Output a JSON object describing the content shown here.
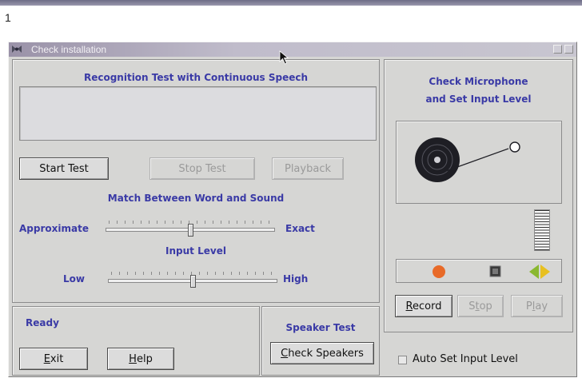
{
  "page": {
    "number": "1"
  },
  "window": {
    "title": "Check installation",
    "buttons": {
      "minimize_icon": "minimize-icon",
      "maximize_icon": "maximize-icon"
    }
  },
  "recognition": {
    "heading": "Recognition Test with Continuous Speech",
    "output_text": "",
    "start_label": "Start Test",
    "stop_label": "Stop Test",
    "playback_label": "Playback",
    "match_heading": "Match Between Word and Sound",
    "match_low_label": "Approximate",
    "match_high_label": "Exact",
    "match_value": 0.5,
    "input_heading": "Input Level",
    "input_low_label": "Low",
    "input_high_label": "High",
    "input_value": 0.5,
    "status": "Ready"
  },
  "speaker": {
    "heading": "Speaker Test",
    "check_label": "Check Speakers"
  },
  "bottom": {
    "exit_label": "Exit",
    "help_label": "Help"
  },
  "microphone": {
    "heading_line1": "Check Microphone",
    "heading_line2": "and Set Input Level",
    "record_label": "Record",
    "stop_label": "Stop",
    "play_label": "Play",
    "auto_set_label": "Auto Set Input Level",
    "auto_set_checked": false,
    "level_meter_value": 1.0
  },
  "colors": {
    "heading_text": "#3a3aa6",
    "record_dot": "#e86a28",
    "play_arrow": "#8ab830",
    "title_bar": "#9a92a8"
  }
}
